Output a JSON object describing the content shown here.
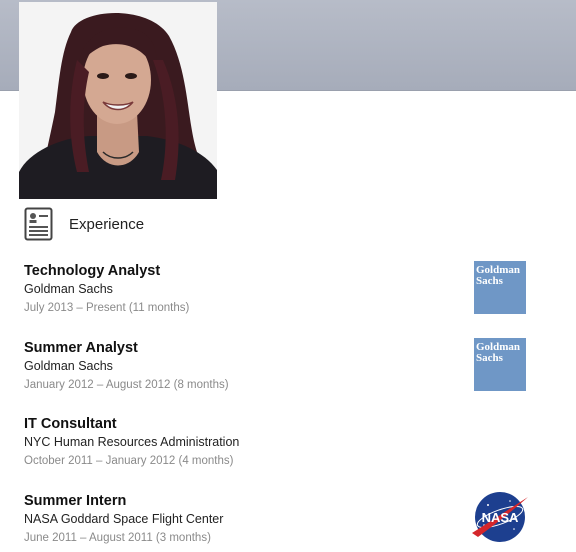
{
  "profile": {
    "photo_alt": "profile-photo"
  },
  "experience": {
    "section_title": "Experience",
    "entries": [
      {
        "title": "Technology Analyst",
        "company": "Goldman Sachs",
        "dates": "July 2013 – Present (11 months)",
        "logo": "goldman-sachs-logo"
      },
      {
        "title": "Summer Analyst",
        "company": "Goldman Sachs",
        "dates": "January 2012 – August 2012 (8 months)",
        "logo": "goldman-sachs-logo"
      },
      {
        "title": "IT Consultant",
        "company": "NYC Human Resources Administration",
        "dates": "October 2011 – January 2012 (4 months)",
        "logo": ""
      },
      {
        "title": "Summer Intern",
        "company": "NASA Goddard Space Flight Center",
        "dates": "June 2011 – August 2011 (3 months)",
        "logo": "nasa-logo"
      }
    ]
  },
  "logos": {
    "goldman_line1": "Goldman",
    "goldman_line2": "Sachs",
    "nasa_text": "NASA"
  },
  "colors": {
    "banner": "#aab0be",
    "goldman_blue": "#6f97c6",
    "nasa_blue": "#1d3f8f",
    "nasa_red": "#d4262b"
  }
}
